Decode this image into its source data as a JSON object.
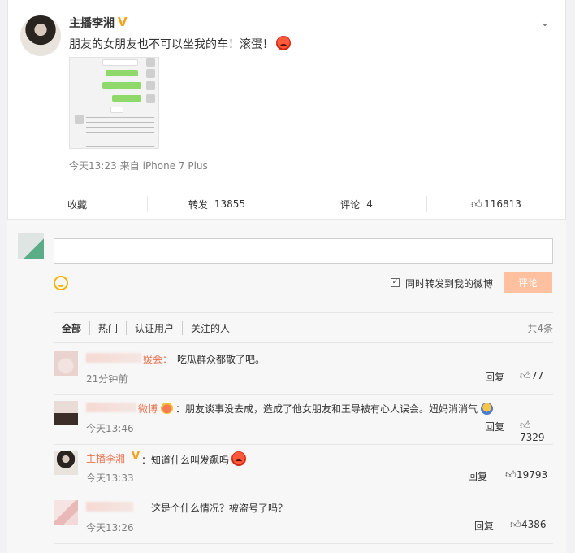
{
  "post": {
    "author": "主播李湘",
    "text": "朋友的女朋友也不可以坐我的车！滚蛋！",
    "time": "今天13:23",
    "source_prefix": "来自",
    "source": "iPhone 7 Plus"
  },
  "actions": {
    "favorite": "收藏",
    "repost_label": "转发",
    "repost_count": "13855",
    "comment_label": "评论",
    "comment_count": "4",
    "like_count": "116813"
  },
  "composer": {
    "input_value": "",
    "repost_option": "同时转发到我的微博",
    "repost_checked": true,
    "submit_label": "评论"
  },
  "filters": {
    "tabs": [
      "全部",
      "热门",
      "认证用户",
      "关注的人"
    ],
    "total": "共4条"
  },
  "comments": [
    {
      "name_suffix": "媛会：",
      "text": "吃瓜群众都散了吧。",
      "time": "21分钟前",
      "reply": "回复",
      "likes": "77"
    },
    {
      "name_suffix": "微博",
      "text": "：朋友谈事没去成，造成了他女朋友和王导被有心人误会。妞妈消消气",
      "time": "今天13:46",
      "reply": "回复",
      "likes": "7329"
    },
    {
      "name": "主播李湘",
      "text": "：知道什么叫发飙吗",
      "time": "今天13:33",
      "reply": "回复",
      "likes": "19793"
    },
    {
      "text": "这是个什么情况？被盗号了吗？",
      "time": "今天13:26",
      "reply": "回复",
      "likes": "4386"
    }
  ],
  "colors": {
    "accent_orange": "#eb7350",
    "submit_disabled": "#ffc09f",
    "vip_gold": "#f7a21c"
  },
  "icons": [
    "chevron-down-icon",
    "angry-emoji-icon",
    "thumb-up-icon",
    "smile-icon",
    "checkbox-icon",
    "vip-badge-icon"
  ]
}
